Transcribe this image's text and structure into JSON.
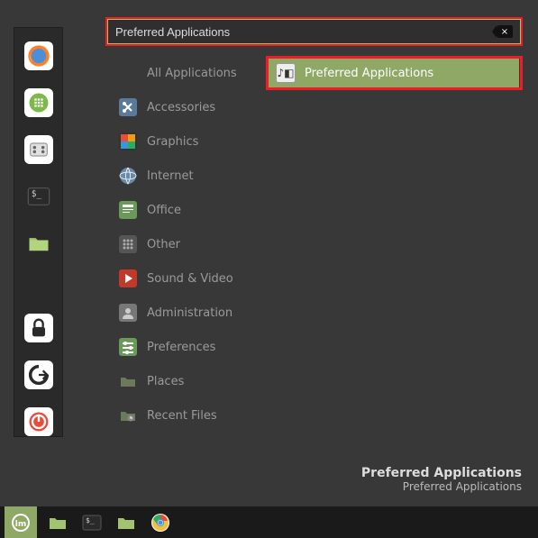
{
  "search": {
    "value": "Preferred Applications",
    "clear_glyph": "×"
  },
  "categories": [
    {
      "id": "all",
      "label": "All Applications"
    },
    {
      "id": "accessories",
      "label": "Accessories"
    },
    {
      "id": "graphics",
      "label": "Graphics"
    },
    {
      "id": "internet",
      "label": "Internet"
    },
    {
      "id": "office",
      "label": "Office"
    },
    {
      "id": "other",
      "label": "Other"
    },
    {
      "id": "sound",
      "label": "Sound & Video"
    },
    {
      "id": "admin",
      "label": "Administration"
    },
    {
      "id": "prefs",
      "label": "Preferences"
    },
    {
      "id": "places",
      "label": "Places"
    },
    {
      "id": "recent",
      "label": "Recent Files"
    }
  ],
  "result": {
    "label": "Preferred Applications"
  },
  "tooltip": {
    "title": "Preferred Applications",
    "subtitle": "Preferred Applications"
  },
  "favorites": [
    {
      "id": "firefox"
    },
    {
      "id": "hexchat"
    },
    {
      "id": "software"
    },
    {
      "id": "terminal"
    },
    {
      "id": "files"
    },
    {
      "id": "lock"
    },
    {
      "id": "logout"
    },
    {
      "id": "power"
    }
  ],
  "taskbar": [
    {
      "id": "menu"
    },
    {
      "id": "files"
    },
    {
      "id": "terminal"
    },
    {
      "id": "files2"
    },
    {
      "id": "chrome"
    }
  ]
}
